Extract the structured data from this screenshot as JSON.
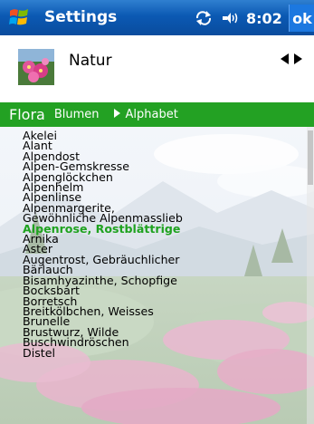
{
  "titlebar": {
    "title": "Settings",
    "time": "8:02",
    "ok_label": "ok"
  },
  "header": {
    "title": "Natur"
  },
  "tabs": {
    "main": "Flora",
    "items": [
      "Blumen",
      "Alphabet"
    ]
  },
  "list": {
    "items": [
      "Akelei",
      "Alant",
      "Alpendost",
      "Alpen-Gemskresse",
      "Alpenglöckchen",
      "Alpenhelm",
      "Alpenlinse",
      "Alpenmargerite,",
      "Gewöhnliche Alpenmasslieb",
      "Alpenrose, Rostblättrige",
      "Arnika",
      "Aster",
      "Augentrost, Gebräuchlicher",
      "Bärlauch",
      "Bisamhyazinthe, Schopfige",
      "Bocksbart",
      "Borretsch",
      "Breitkölbchen, Weisses",
      "Brunelle",
      "Brustwurz, Wilde",
      "Buschwindröschen",
      "Distel"
    ],
    "selected_index": 9
  },
  "colors": {
    "titlebar": "#0b59b3",
    "tabbar": "#23a123",
    "selected_text": "#1fa21f"
  },
  "icons": {
    "start": "windows-flag-icon",
    "connectivity": "sync-arrows-icon",
    "volume": "speaker-icon",
    "app": "flower-icon"
  }
}
